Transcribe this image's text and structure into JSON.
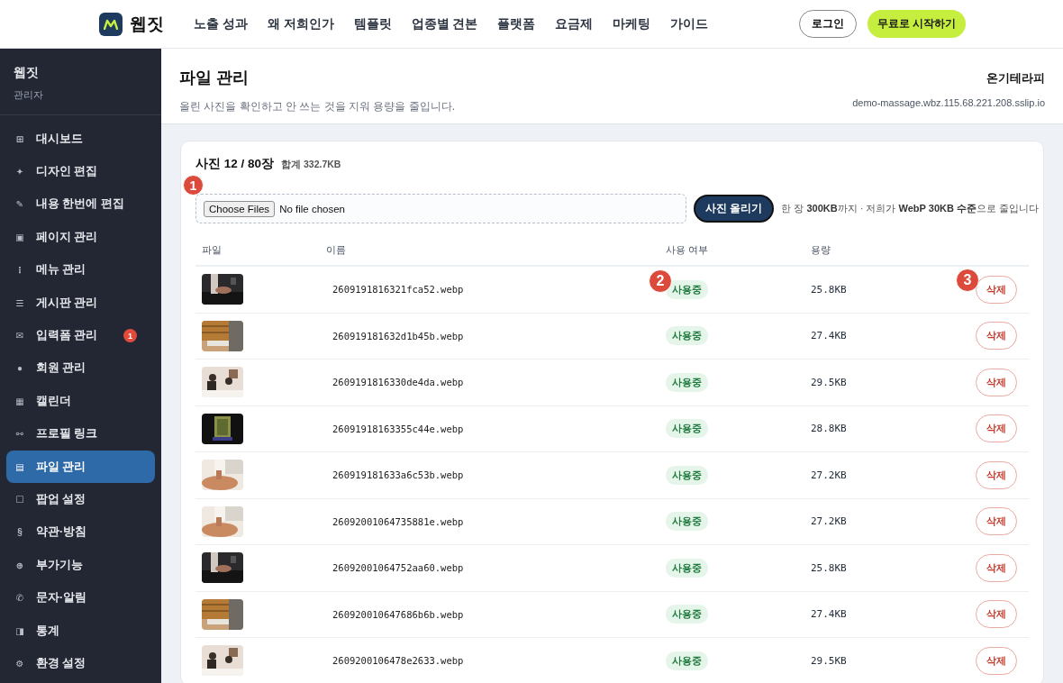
{
  "topbar": {
    "brand": "웹짓",
    "nav": [
      "노출 성과",
      "왜 저희인가",
      "템플릿",
      "업종별 견본",
      "플랫폼",
      "요금제",
      "마케팅",
      "가이드"
    ],
    "login": "로그인",
    "cta": "무료로 시작하기"
  },
  "sidebar": {
    "title": "웹짓",
    "subtitle": "관리자",
    "items": [
      {
        "icon": "⊞",
        "label": "대시보드",
        "selected": false
      },
      {
        "icon": "✦",
        "label": "디자인 편집",
        "selected": false
      },
      {
        "icon": "✎",
        "label": "내용 한번에 편집",
        "selected": false
      },
      {
        "icon": "▣",
        "label": "페이지 관리",
        "selected": false
      },
      {
        "icon": "⋮",
        "label": "메뉴 관리",
        "selected": false
      },
      {
        "icon": "☰",
        "label": "게시판 관리",
        "selected": false
      },
      {
        "icon": "✉",
        "label": "입력폼 관리",
        "selected": false,
        "badge": "1"
      },
      {
        "icon": "●",
        "label": "회원 관리",
        "selected": false
      },
      {
        "icon": "▦",
        "label": "캘린더",
        "selected": false
      },
      {
        "icon": "⚯",
        "label": "프로필 링크",
        "selected": false
      },
      {
        "icon": "▤",
        "label": "파일 관리",
        "selected": true
      },
      {
        "icon": "☐",
        "label": "팝업 설정",
        "selected": false
      },
      {
        "icon": "§",
        "label": "약관·방침",
        "selected": false
      },
      {
        "icon": "⊕",
        "label": "부가기능",
        "selected": false
      },
      {
        "icon": "✆",
        "label": "문자·알림",
        "selected": false
      },
      {
        "icon": "◨",
        "label": "통계",
        "selected": false
      },
      {
        "icon": "⚙",
        "label": "환경 설정",
        "selected": false
      }
    ]
  },
  "header": {
    "title": "파일 관리",
    "subtitle": "올린 사진을 확인하고 안 쓰는 것을 지워 용량을 줄입니다.",
    "site_name": "온기테라피",
    "site_url": "demo-massage.wbz.115.68.221.208.sslip.io"
  },
  "panel": {
    "count": "사진 12 / 80장",
    "total": "합계 332.7KB",
    "file_button": "Choose Files",
    "file_status": "No file chosen",
    "upload": "사진 올리기",
    "hint": "한 장 **300KB**까지 · 저희가 **WebP 30KB 수준**으로 줄입니다"
  },
  "table": {
    "columns": [
      "파일",
      "이름",
      "사용 여부",
      "용량"
    ],
    "rows": [
      {
        "name": "2609191816321fca52.webp",
        "status": "사용중",
        "size": "25.8KB",
        "action": "삭제"
      },
      {
        "name": "260919181632d1b45b.webp",
        "status": "사용중",
        "size": "27.4KB",
        "action": "삭제"
      },
      {
        "name": "2609191816330de4da.webp",
        "status": "사용중",
        "size": "29.5KB",
        "action": "삭제"
      },
      {
        "name": "26091918163355c44e.webp",
        "status": "사용중",
        "size": "28.8KB",
        "action": "삭제"
      },
      {
        "name": "260919181633a6c53b.webp",
        "status": "사용중",
        "size": "27.2KB",
        "action": "삭제"
      },
      {
        "name": "26092001064735881e.webp",
        "status": "사용중",
        "size": "27.2KB",
        "action": "삭제"
      },
      {
        "name": "26092001064752aa60.webp",
        "status": "사용중",
        "size": "25.8KB",
        "action": "삭제"
      },
      {
        "name": "260920010647686b6b.webp",
        "status": "사용중",
        "size": "27.4KB",
        "action": "삭제"
      },
      {
        "name": "2609200106478e2633.webp",
        "status": "사용중",
        "size": "29.5KB",
        "action": "삭제"
      }
    ]
  },
  "markers": [
    "1",
    "2",
    "3"
  ]
}
